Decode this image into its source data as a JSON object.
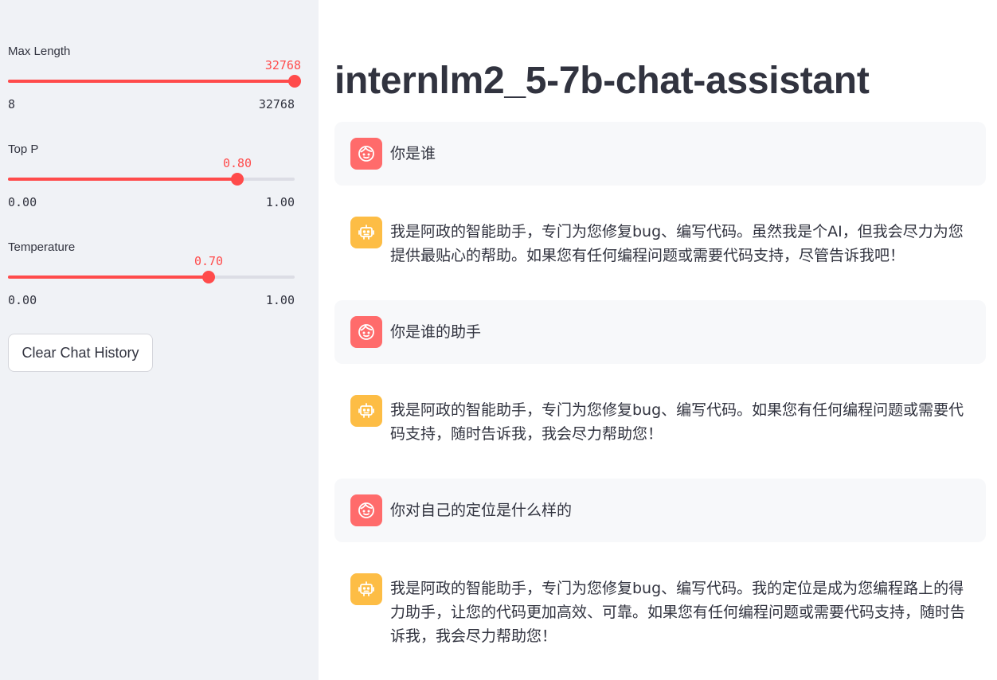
{
  "sidebar": {
    "sliders": [
      {
        "label": "Max Length",
        "value": "32768",
        "min": "8",
        "max": "32768",
        "fraction": 1.0
      },
      {
        "label": "Top P",
        "value": "0.80",
        "min": "0.00",
        "max": "1.00",
        "fraction": 0.8
      },
      {
        "label": "Temperature",
        "value": "0.70",
        "min": "0.00",
        "max": "1.00",
        "fraction": 0.7
      }
    ],
    "clear_button": "Clear Chat History"
  },
  "main": {
    "title": "internlm2_5-7b-chat-assistant",
    "messages": [
      {
        "role": "user",
        "text": "你是谁"
      },
      {
        "role": "assistant",
        "text": "我是阿政的智能助手，专门为您修复bug、编写代码。虽然我是个AI，但我会尽力为您提供最贴心的帮助。如果您有任何编程问题或需要代码支持，尽管告诉我吧！"
      },
      {
        "role": "user",
        "text": "你是谁的助手"
      },
      {
        "role": "assistant",
        "text": "我是阿政的智能助手，专门为您修复bug、编写代码。如果您有任何编程问题或需要代码支持，随时告诉我，我会尽力帮助您！"
      },
      {
        "role": "user",
        "text": "你对自己的定位是什么样的"
      },
      {
        "role": "assistant",
        "text": "我是阿政的智能助手，专门为您修复bug、编写代码。我的定位是成为您编程路上的得力助手，让您的代码更加高效、可靠。如果您有任何编程问题或需要代码支持，随时告诉我，我会尽力帮助您！"
      }
    ]
  },
  "colors": {
    "accent": "#ff4b4b",
    "user_avatar": "#ff6b6b",
    "assistant_avatar": "#fdbd45",
    "sidebar_bg": "#f0f2f6"
  },
  "icons": {
    "user_avatar": "smiley-face-icon",
    "assistant_avatar": "robot-icon"
  }
}
